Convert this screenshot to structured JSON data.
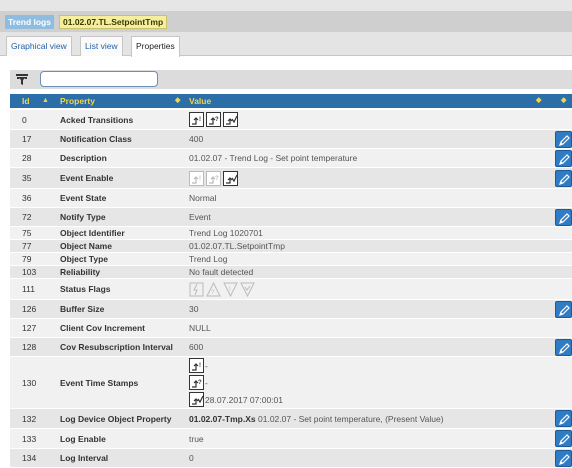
{
  "breadcrumb": {
    "root": "Trend logs",
    "current": "01.02.07.TL.SetpointTmp"
  },
  "tabs": [
    {
      "label": "Graphical view",
      "active": false
    },
    {
      "label": "List view",
      "active": false
    },
    {
      "label": "Properties",
      "active": true
    }
  ],
  "filter": {
    "value": "",
    "placeholder": ""
  },
  "table": {
    "columns": {
      "id": "Id",
      "property": "Property",
      "value": "Value"
    },
    "rows": [
      {
        "id": "0",
        "property": "Acked Transitions",
        "value": "",
        "kind": "transitions",
        "editable": false
      },
      {
        "id": "17",
        "property": "Notification Class",
        "value": "400",
        "kind": "text",
        "editable": true
      },
      {
        "id": "28",
        "property": "Description",
        "value": "01.02.07 - Trend Log - Set point temperature",
        "kind": "text",
        "editable": true
      },
      {
        "id": "35",
        "property": "Event Enable",
        "value": "",
        "kind": "transitions-faint",
        "editable": true
      },
      {
        "id": "36",
        "property": "Event State",
        "value": "Normal",
        "kind": "text",
        "editable": false
      },
      {
        "id": "72",
        "property": "Notify Type",
        "value": "Event",
        "kind": "text",
        "editable": true
      },
      {
        "id": "75",
        "property": "Object Identifier",
        "value": "Trend Log 1020701",
        "kind": "text",
        "editable": false
      },
      {
        "id": "77",
        "property": "Object Name",
        "value": "01.02.07.TL.SetpointTmp",
        "kind": "text",
        "editable": false
      },
      {
        "id": "79",
        "property": "Object Type",
        "value": "Trend Log",
        "kind": "text",
        "editable": false
      },
      {
        "id": "103",
        "property": "Reliability",
        "value": "No fault detected",
        "kind": "text",
        "editable": false
      },
      {
        "id": "111",
        "property": "Status Flags",
        "value": "",
        "kind": "flags",
        "editable": false
      },
      {
        "id": "126",
        "property": "Buffer Size",
        "value": "30",
        "kind": "text",
        "editable": true
      },
      {
        "id": "127",
        "property": "Client Cov Increment",
        "value": "NULL",
        "kind": "text",
        "editable": false
      },
      {
        "id": "128",
        "property": "Cov Resubscription Interval",
        "value": "600",
        "kind": "text",
        "editable": true
      },
      {
        "id": "130",
        "property": "Event Time Stamps",
        "value": "",
        "kind": "timestamps",
        "editable": false,
        "stamps": [
          "-",
          "-",
          "28.07.2017 07:00:01"
        ]
      },
      {
        "id": "132",
        "property": "Log Device Object Property",
        "value_bold": "01.02.07-Tmp.Xs",
        "value": "01.02.07 - Set point temperature, (Present Value)",
        "kind": "mixed",
        "editable": true
      },
      {
        "id": "133",
        "property": "Log Enable",
        "value": "true",
        "kind": "text",
        "editable": true
      },
      {
        "id": "134",
        "property": "Log Interval",
        "value": "0",
        "kind": "text",
        "editable": true
      }
    ]
  },
  "icons": {
    "filter": "filter-icon",
    "edit": "pencil-icon",
    "sort_asc": "sort-ascending-icon",
    "sort_both": "sort-both-icon"
  },
  "colors": {
    "header_bg": "#2c6fa8",
    "header_text": "#f2d54b",
    "edit_button": "#2f7bc4"
  }
}
